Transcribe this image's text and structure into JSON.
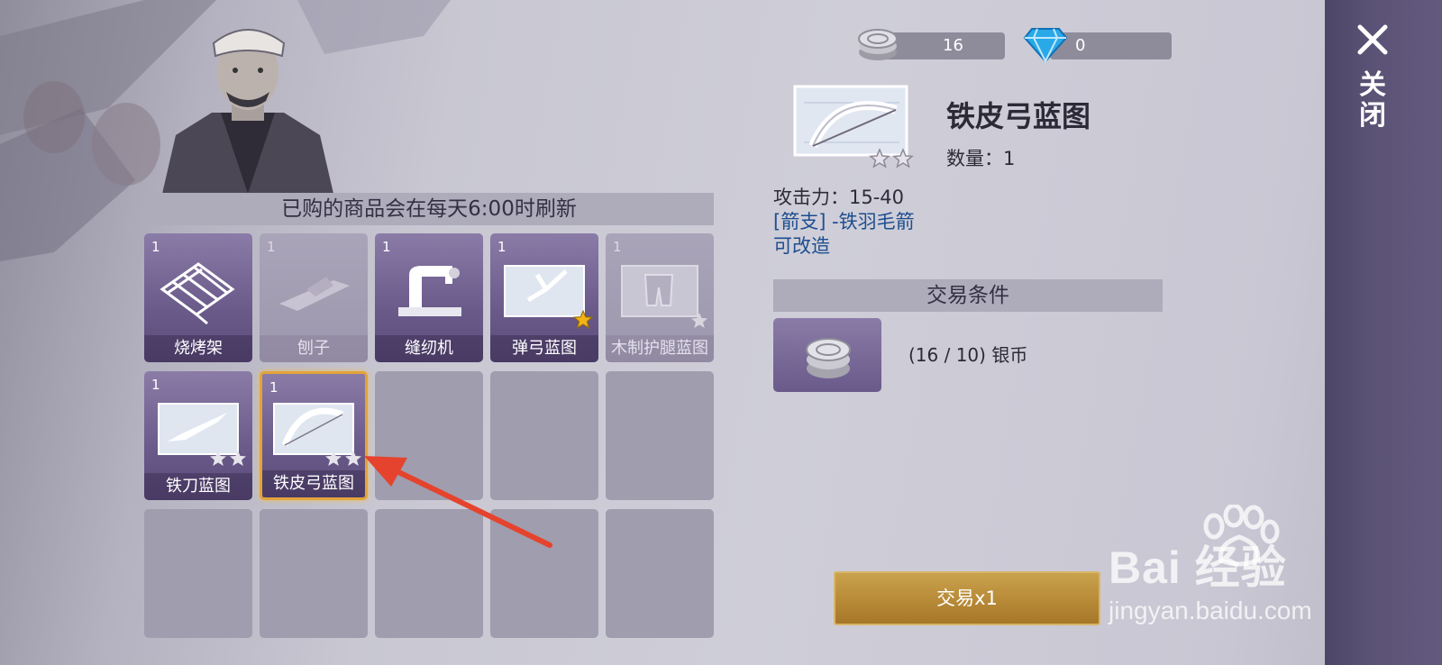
{
  "currency": {
    "silver": {
      "icon": "silver-coin-icon",
      "value": "16"
    },
    "gems": {
      "icon": "diamond-icon",
      "value": "0"
    }
  },
  "shop": {
    "notice": "已购的商品会在每天6:00时刷新",
    "items": [
      {
        "qty": "1",
        "name": "烧烤架",
        "icon": "grill-icon",
        "state": "filled"
      },
      {
        "qty": "1",
        "name": "刨子",
        "icon": "wood-plane-icon",
        "state": "dim"
      },
      {
        "qty": "1",
        "name": "缝纫机",
        "icon": "sewing-machine-icon",
        "state": "filled"
      },
      {
        "qty": "1",
        "name": "弹弓蓝图",
        "icon": "slingshot-blueprint-icon",
        "state": "filled",
        "stars": 1
      },
      {
        "qty": "1",
        "name": "木制护腿蓝图",
        "icon": "leg-guard-blueprint-icon",
        "state": "dim",
        "stars": 1
      },
      {
        "qty": "1",
        "name": "铁刀蓝图",
        "icon": "knife-blueprint-icon",
        "state": "filled",
        "stars": 2
      },
      {
        "qty": "1",
        "name": "铁皮弓蓝图",
        "icon": "bow-blueprint-icon",
        "state": "selected",
        "stars": 2
      }
    ]
  },
  "detail": {
    "icon": "bow-blueprint-icon",
    "title": "铁皮弓蓝图",
    "count_label": "数量：1",
    "stars": 2,
    "attack": "攻击力：15-40",
    "ammo": "[箭支] -铁羽毛箭",
    "upgradable": "可改造",
    "condition_header": "交易条件",
    "condition_icon": "silver-coin-icon",
    "condition_text": "(16 / 10) 银币",
    "trade_button": "交易x1"
  },
  "sidebar": {
    "close_label": "关闭",
    "close_icon": "close-icon"
  },
  "watermark": {
    "brand": "Bai  经验",
    "url": "jingyan.baidu.com"
  },
  "colors": {
    "accent_gold": "#e2a43a",
    "button_gold": "#b98c39",
    "slot_purple": "#6a5a8a",
    "link_blue": "#1d4e8f"
  }
}
